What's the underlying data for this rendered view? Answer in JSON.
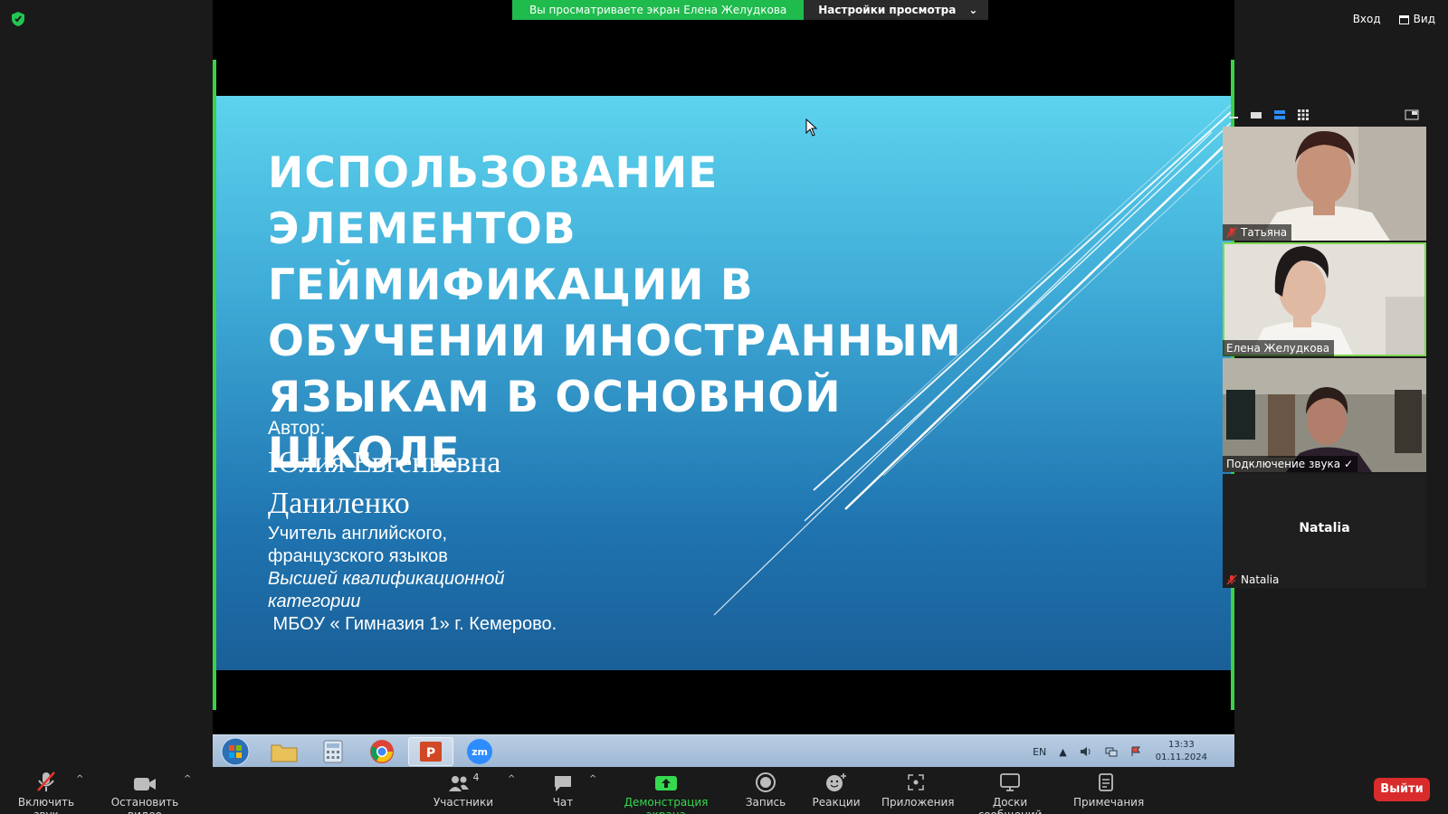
{
  "top_bar": {
    "share_banner_text": "Вы просматриваете экран Елена Желудкова",
    "view_options_label": "Настройки просмотра",
    "signin_label": "Вход",
    "view_label": "Вид"
  },
  "slide": {
    "title": "ИСПОЛЬЗОВАНИЕ ЭЛЕМЕНТОВ ГЕЙМИФИКАЦИИ В ОБУЧЕНИИ ИНОСТРАННЫМ ЯЗЫКАМ В ОСНОВНОЙ ШКОЛЕ",
    "author_label": "Автор:",
    "author_name": "Юлия Евгеньевна Даниленко",
    "line1": "Учитель английского,",
    "line2": "французского языков",
    "line3": "Высшей квалификационной",
    "line4": "категории",
    "line5": " МБОУ « Гимназия 1» г. Кемерово."
  },
  "taskbar": {
    "lang": "EN",
    "time": "13:33",
    "date": "01.11.2024"
  },
  "participants": [
    {
      "name": "Татьяна",
      "muted": true
    },
    {
      "name": "Елена Желудкова",
      "muted": false,
      "active": true
    },
    {
      "name": "Подключение звука ✓",
      "muted": false
    },
    {
      "name": "Natalia",
      "muted": true,
      "video_off": true
    }
  ],
  "toolbar": {
    "unmute_label": "Включить звук",
    "stop_video_label": "Остановить видео",
    "participants_label": "Участники",
    "participants_count": "4",
    "chat_label": "Чат",
    "share_screen_label": "Демонстрация экрана",
    "record_label": "Запись",
    "reactions_label": "Реакции",
    "apps_label": "Приложения",
    "whiteboards_label": "Доски сообщений",
    "notes_label": "Примечания",
    "exit_label": "Выйти"
  },
  "colors": {
    "banner_green": "#1fbb4d",
    "frame_green": "#3bd24a",
    "exit_red": "#d92b2b",
    "slide_top": "#5dd3ee",
    "slide_bottom": "#1a5f98"
  }
}
